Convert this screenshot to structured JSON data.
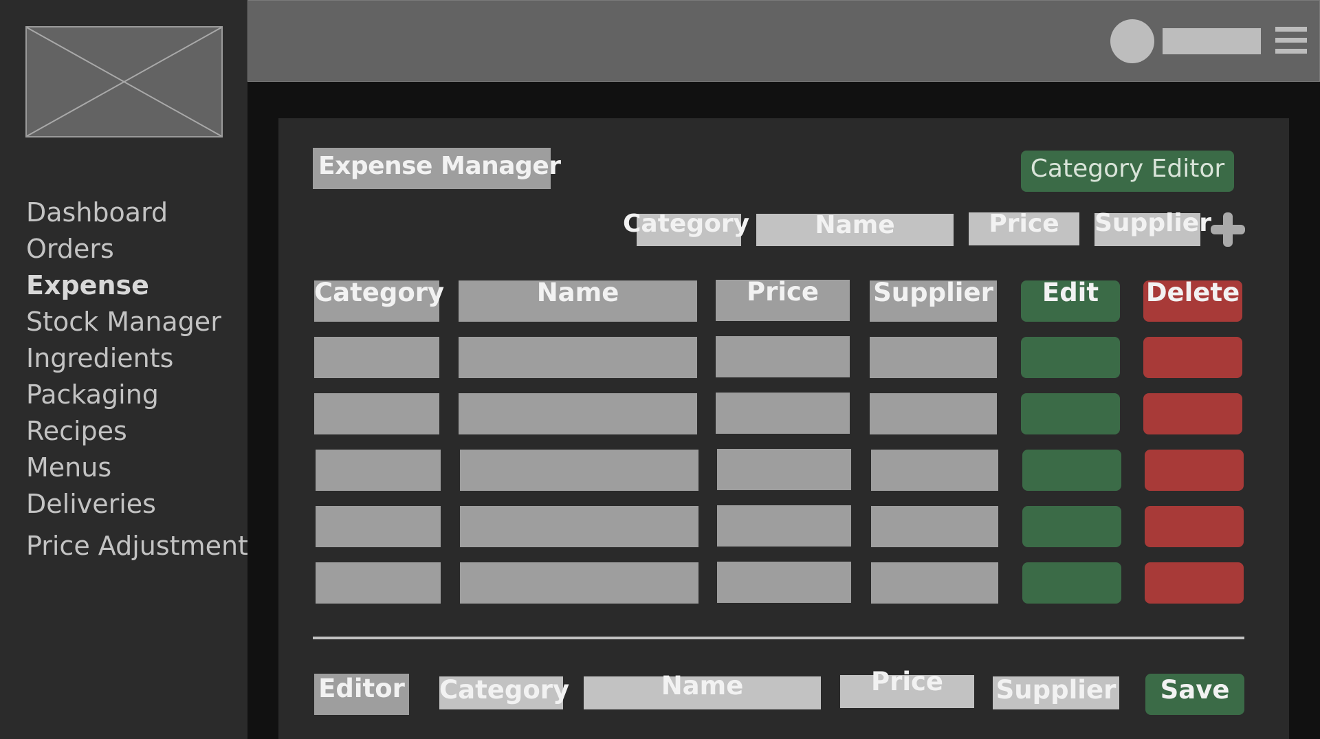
{
  "sidebar": {
    "logo": "image-placeholder-icon",
    "items": [
      {
        "label": "Dashboard",
        "active": false
      },
      {
        "label": "Orders",
        "active": false
      },
      {
        "label": "Expense",
        "active": true
      },
      {
        "label": "Stock Manager",
        "active": false
      },
      {
        "label": "Ingredients",
        "active": false
      },
      {
        "label": "Packaging",
        "active": false
      },
      {
        "label": "Recipes",
        "active": false
      },
      {
        "label": "Menus",
        "active": false
      },
      {
        "label": "Deliveries",
        "active": false
      },
      {
        "label": "Price Adjustment",
        "active": false
      }
    ]
  },
  "topbar": {
    "avatar": "avatar-icon",
    "menu_icon": "hamburger-menu-icon"
  },
  "main": {
    "title": "Expense Manager",
    "category_editor_label": "Category Editor",
    "add_form": {
      "category": "Category",
      "name": "Name",
      "price": "Price",
      "supplier": "Supplier",
      "add_icon": "plus-icon"
    },
    "table": {
      "headers": {
        "category": "Category",
        "name": "Name",
        "price": "Price",
        "supplier": "Supplier",
        "edit": "Edit",
        "delete": "Delete"
      },
      "rows": 5
    },
    "editor": {
      "title": "Editor",
      "category": "Category",
      "name": "Name",
      "price": "Price",
      "supplier": "Supplier",
      "save_label": "Save"
    }
  },
  "colors": {
    "edit": "#3b6b47",
    "delete": "#a83a38",
    "placeholder": "#9e9e9e"
  }
}
